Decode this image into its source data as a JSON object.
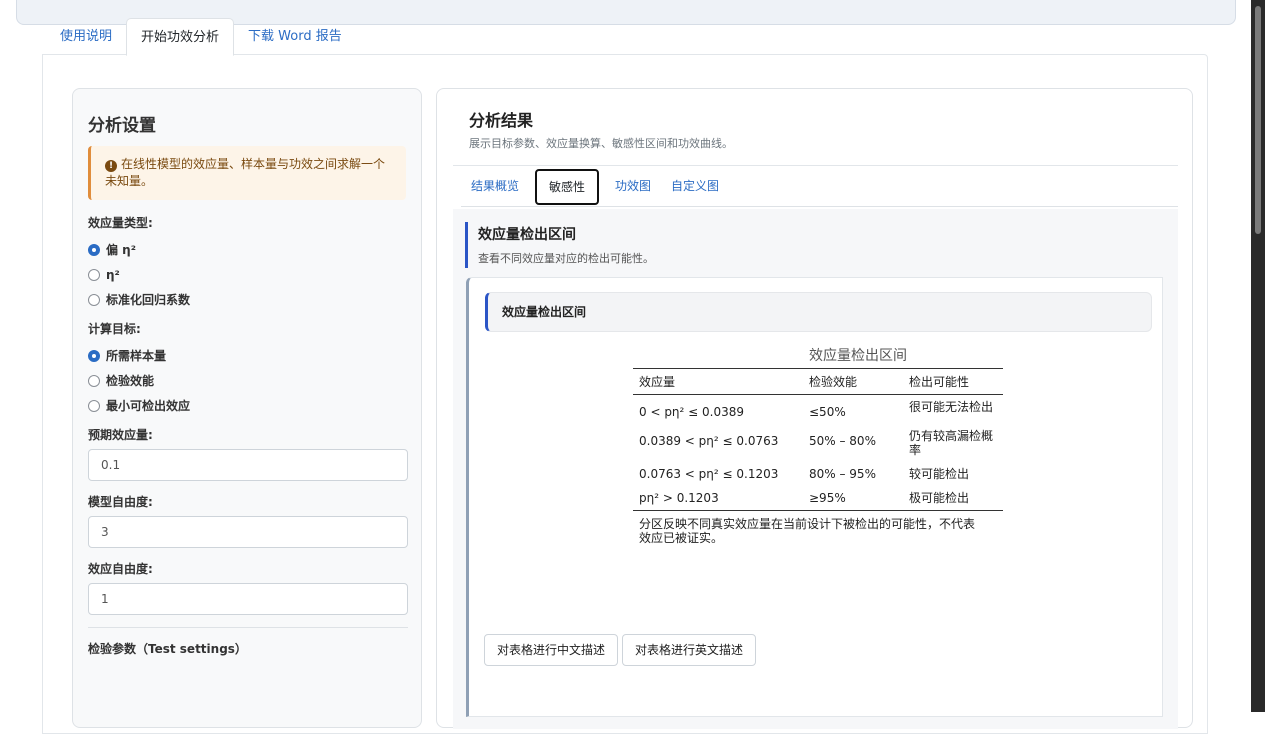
{
  "main_tabs": [
    {
      "label": "使用说明"
    },
    {
      "label": "开始功效分析"
    },
    {
      "label": "下载 Word 报告"
    }
  ],
  "sidebar": {
    "title": "分析设置",
    "alert": "在线性模型的效应量、样本量与功效之间求解一个未知量。",
    "effect_type": {
      "label": "效应量类型:",
      "options": [
        "偏 η²",
        "η²",
        "标准化回归系数"
      ],
      "selected": "偏 η²"
    },
    "target": {
      "label": "计算目标:",
      "options": [
        "所需样本量",
        "检验效能",
        "最小可检出效应"
      ],
      "selected": "所需样本量"
    },
    "expected_effect": {
      "label": "预期效应量:",
      "value": "0.1"
    },
    "model_df": {
      "label": "模型自由度:",
      "value": "3"
    },
    "effect_df": {
      "label": "效应自由度:",
      "value": "1"
    },
    "test_settings_label": "检验参数（Test settings）"
  },
  "results": {
    "title": "分析结果",
    "subtitle": "展示目标参数、效应量换算、敏感性区间和功效曲线。",
    "tabs": [
      {
        "label": "结果概览"
      },
      {
        "label": "敏感性"
      },
      {
        "label": "功效图"
      },
      {
        "label": "自定义图"
      }
    ],
    "section_title": "效应量检出区间",
    "section_sub": "查看不同效应量对应的检出可能性。",
    "panel_title": "效应量检出区间",
    "table": {
      "caption": "效应量检出区间",
      "headers": [
        "效应量",
        "检验效能",
        "检出可能性"
      ],
      "rows": [
        [
          "0 < pη² ≤ 0.0389",
          "≤50%",
          "很可能无法检出"
        ],
        [
          "0.0389 < pη² ≤ 0.0763",
          "50% – 80%",
          "仍有较高漏检概率"
        ],
        [
          "0.0763 < pη² ≤ 0.1203",
          "80% – 95%",
          "较可能检出"
        ],
        [
          "pη² > 0.1203",
          "≥95%",
          "极可能检出"
        ]
      ],
      "note": "分区反映不同真实效应量在当前设计下被检出的可能性，不代表效应已被证实。"
    },
    "buttons": {
      "describe_cn": "对表格进行中文描述",
      "describe_en": "对表格进行英文描述"
    }
  }
}
